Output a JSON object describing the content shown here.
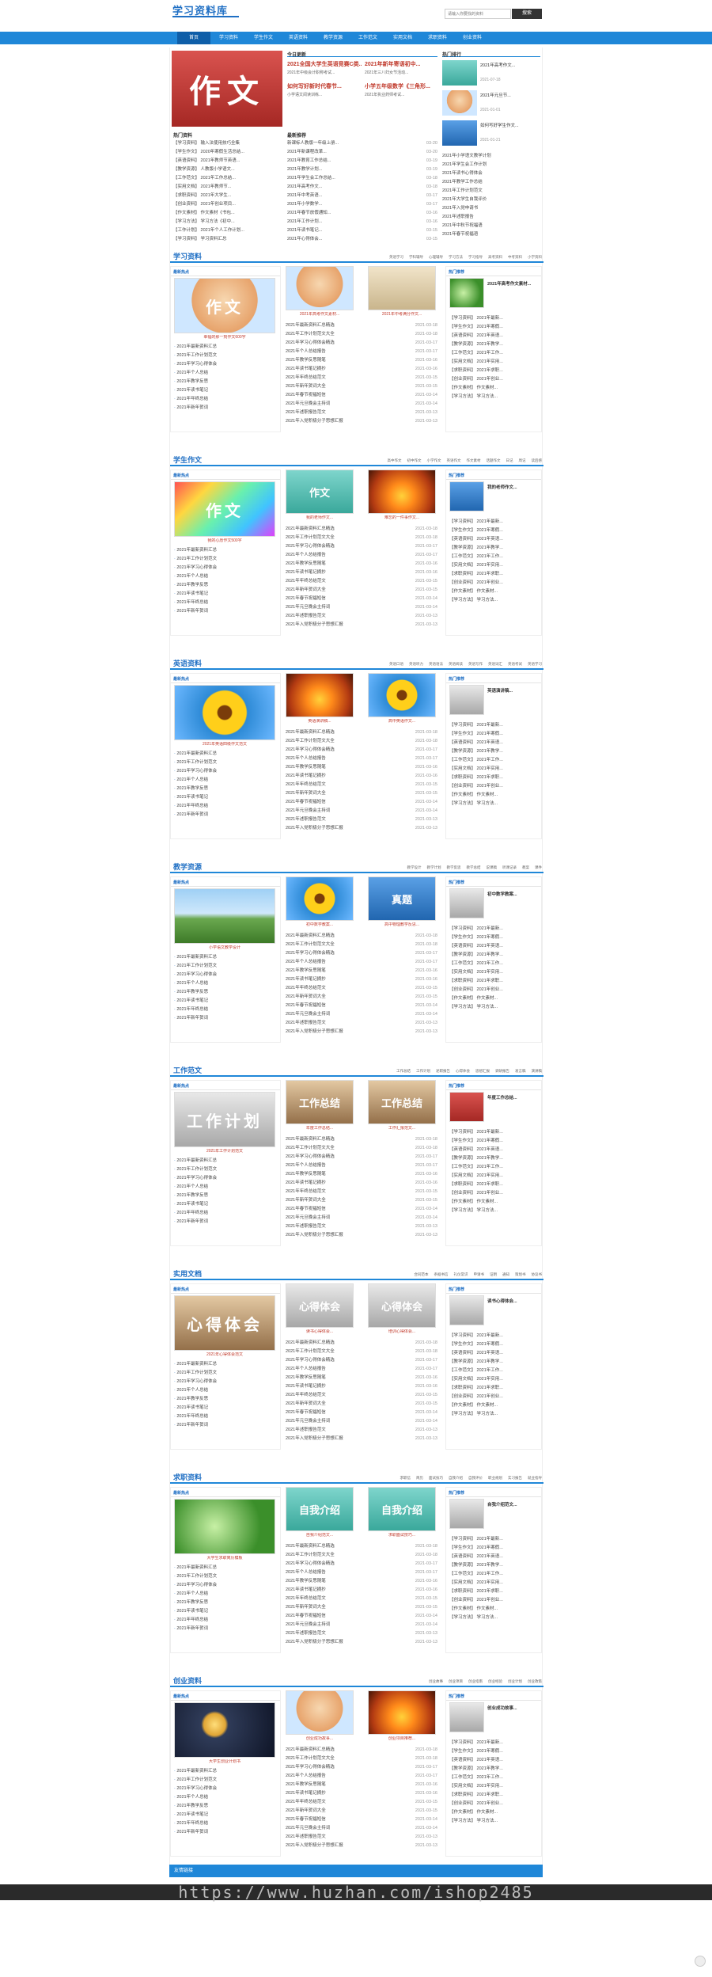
{
  "header": {
    "logo": "学习资料库",
    "search_placeholder": "请输入你要找的资料",
    "search_button": "搜索"
  },
  "nav": [
    "首页",
    "学习资料",
    "学生作文",
    "英语资料",
    "教学资源",
    "工作范文",
    "实用文档",
    "求职资料",
    "创业资料"
  ],
  "top": {
    "hero_text": "作文",
    "today_title": "今日更新",
    "headline_1": "2021全国大学生英语竞赛C类...",
    "headline_2": "2021年新年寄语初中...",
    "sub_1": "2021年中级会计职称考试...",
    "sub_2": "2021年三八妇女节活动...",
    "headline_3": "如何写好新时代春节...",
    "headline_4": "小学五年级数学《三角形...",
    "sub_3": "小学语文阅读训练...",
    "sub_4": "2021年执业药师考试...",
    "hot_title": "热门资料",
    "hot_list": [
      "【学习资料】 输入法使用技巧全集",
      "【学生作文】 2020年寒假生活总结...",
      "【英语资料】 2021年教师节英语...",
      "【教学资源】 人教版小学语文...",
      "【工作范文】 2021年工作总结...",
      "【实用文档】 2021年教师节...",
      "【求职资料】 2021年大学生...",
      "【创业资料】 2021年创业项目...",
      "【作文素材】 作文素材《书包...",
      "【学习方法】 学习方法《初中...",
      "【工作计划】 2021年个人工作计划...",
      "【学习资料】 学习资料汇总"
    ],
    "latest_title": "最新推荐",
    "latest_list": [
      "新课标人教版一年级上册...",
      "2021年新课程改革...",
      "2021年教育工作总结...",
      "2021年教学计划...",
      "2021年学生会工作总结...",
      "2021年高考作文...",
      "2021年中考英语...",
      "2021年小学数学...",
      "2021年春节放假通知...",
      "2021年工作计划...",
      "2021年读书笔记...",
      "2021年心得体会..."
    ],
    "latest_dates": [
      "03-20",
      "03-20",
      "03-19",
      "03-19",
      "03-18",
      "03-18",
      "03-17",
      "03-17",
      "03-16",
      "03-16",
      "03-15",
      "03-15"
    ],
    "side_title": "热门排行",
    "side_items": [
      {
        "title": "2021年高考作文...",
        "date": "2021-07-18"
      },
      {
        "title": "2021年元旦节...",
        "date": "2021-01-01"
      },
      {
        "title": "如何写好学生作文...",
        "date": "2021-01-21"
      }
    ],
    "side_list": [
      "2021年小学语文教学计划",
      "2021年学生会工作计划",
      "2021年读书心得体会",
      "2021年教学工作总结",
      "2021年工作计划范文",
      "2021年大学生自我评价",
      "2021年入党申请书",
      "2021年述职报告",
      "2021年中秋节祝福语",
      "2021年春节祝福语"
    ]
  },
  "sections": [
    {
      "title": "学习资料",
      "tags": [
        "英语学习",
        "学科辅导",
        "心理辅导",
        "学习方法",
        "学习指导",
        "高考资料",
        "中考资料",
        "小学资料"
      ],
      "box1": "最新热点",
      "box2": "热门推荐",
      "cap_big": "幸福的那一刻作文600字",
      "cap_1": "2021年高考作文素材...",
      "cap_2": "2021年中考满分作文..."
    },
    {
      "title": "学生作文",
      "tags": [
        "高中作文",
        "初中作文",
        "小学作文",
        "英语作文",
        "作文素材",
        "话题作文",
        "日记",
        "周记",
        "读后感"
      ],
      "box1": "最新热点",
      "box2": "热门推荐",
      "cap_big": "我的心愿作文500字",
      "cap_1": "我的老师作文...",
      "cap_2": "难忘的一件事作文..."
    },
    {
      "title": "英语资料",
      "tags": [
        "英语口语",
        "英语听力",
        "英语语法",
        "英语阅读",
        "英语写作",
        "英语词汇",
        "英语考试",
        "英语学习"
      ],
      "box1": "最新热点",
      "box2": "热门推荐",
      "cap_big": "2021年英语四级作文范文",
      "cap_1": "英语演讲稿...",
      "cap_2": "高中英语作文..."
    },
    {
      "title": "教学资源",
      "tags": [
        "教学设计",
        "教学计划",
        "教学反思",
        "教学总结",
        "说课稿",
        "听课记录",
        "教案",
        "课件"
      ],
      "box1": "最新热点",
      "box2": "热门推荐",
      "cap_big": "小学语文教学设计",
      "cap_1": "初中数学教案...",
      "cap_2": "高中物理教学反思..."
    },
    {
      "title": "工作范文",
      "tags": [
        "工作总结",
        "工作计划",
        "述职报告",
        "心得体会",
        "思想汇报",
        "调研报告",
        "发言稿",
        "演讲稿"
      ],
      "box1": "最新热点",
      "box2": "热门推荐",
      "cap_big": "2021年工作计划范文",
      "cap_1": "年度工作总结...",
      "cap_2": "工作汇报范文..."
    },
    {
      "title": "实用文档",
      "tags": [
        "合同范本",
        "条据书信",
        "礼仪常识",
        "申请书",
        "证明",
        "通知",
        "策划书",
        "协议书"
      ],
      "box1": "最新热点",
      "box2": "热门推荐",
      "cap_big": "2021年心得体会范文",
      "cap_1": "读书心得体会...",
      "cap_2": "培训心得体会..."
    },
    {
      "title": "求职资料",
      "tags": [
        "求职信",
        "简历",
        "面试技巧",
        "自我介绍",
        "自我评价",
        "职业规划",
        "实习报告",
        "就业指导"
      ],
      "box1": "最新热点",
      "box2": "热门推荐",
      "cap_big": "大学生求职简历模板",
      "cap_1": "自我介绍范文...",
      "cap_2": "求职面试技巧..."
    },
    {
      "title": "创业资料",
      "tags": [
        "创业故事",
        "创业项目",
        "创业指南",
        "创业经验",
        "创业计划",
        "创业政策"
      ],
      "box1": "最新热点",
      "box2": "热门推荐",
      "cap_big": "大学生创业计划书",
      "cap_1": "创业成功故事...",
      "cap_2": "创业项目推荐..."
    }
  ],
  "section_list": [
    "2021年最新资料汇总",
    "2021年工作计划范文",
    "2021年学习心得体会",
    "2021年个人总结",
    "2021年教学反思",
    "2021年读书笔记",
    "2021年年终总结",
    "2021年新年贺词"
  ],
  "mid_list": [
    "2021年最新资料汇总精选",
    "2021年工作计划范文大全",
    "2021年学习心得体会精选",
    "2021年个人总结报告",
    "2021年教学反思随笔",
    "2021年读书笔记摘抄",
    "2021年年终总结范文",
    "2021年新年贺词大全",
    "2021年春节祝福短信",
    "2021年元旦晚会主持词",
    "2021年述职报告范文",
    "2021年入党积极分子思想汇报"
  ],
  "mid_dates": [
    "2021-03-18",
    "2021-03-18",
    "2021-03-17",
    "2021-03-17",
    "2021-03-16",
    "2021-03-16",
    "2021-03-15",
    "2021-03-15",
    "2021-03-14",
    "2021-03-14",
    "2021-03-13",
    "2021-03-13"
  ],
  "right_list": [
    "【学习资料】 2021年最新...",
    "【学生作文】 2021年寒假...",
    "【英语资料】 2021年英语...",
    "【教学资源】 2021年教学...",
    "【工作范文】 2021年工作...",
    "【实用文档】 2021年实用...",
    "【求职资料】 2021年求职...",
    "【创业资料】 2021年创业...",
    "【作文素材】 作文素材...",
    "【学习方法】 学习方法..."
  ],
  "footer": "友情链接",
  "watermark": "https://www.huzhan.com/ishop2485"
}
